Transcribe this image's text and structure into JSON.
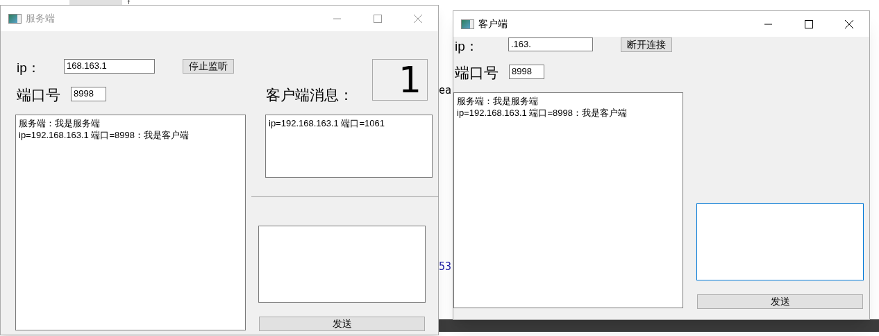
{
  "background_editor": {
    "texts": [
      "f",
      "ea",
      "53"
    ]
  },
  "server_window": {
    "title": "服务端",
    "active": false,
    "ip_label": "ip：",
    "ip_value": "168.163.1",
    "stop_button": "停止监听",
    "lcd_value": "1",
    "port_label": "端口号",
    "port_value": "8998",
    "client_messages_label": "客户端消息：",
    "log": [
      "服务端：我是服务端",
      "ip=192.168.163.1 端口=8998：我是客户端"
    ],
    "client_list": [
      "ip=192.168.163.1 端口=1061"
    ],
    "message_input": {
      "focused": false
    },
    "send_button": "发送"
  },
  "client_window": {
    "title": "客户端",
    "active": true,
    "ip_label": "ip：",
    "ip_value": ".163.",
    "disconnect_button": "断开连接",
    "port_label": "端口号",
    "port_value": "8998",
    "log": [
      "服务端：我是服务端",
      "ip=192.168.163.1 端口=8998：我是客户端"
    ],
    "message_input": {
      "focused": true
    },
    "send_button": "发送"
  }
}
